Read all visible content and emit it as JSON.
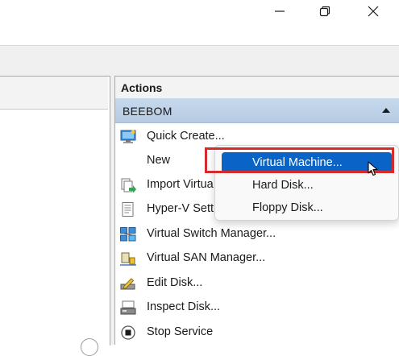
{
  "window": {
    "controls": [
      {
        "name": "minimize-icon"
      },
      {
        "name": "maximize-icon"
      },
      {
        "name": "close-icon"
      }
    ]
  },
  "actions": {
    "title": "Actions",
    "group": "BEEBOM",
    "items": [
      {
        "label": "Quick Create...",
        "icon": "quick-create-icon"
      },
      {
        "label": "New",
        "icon": ""
      },
      {
        "label": "Import Virtua",
        "icon": "import-icon"
      },
      {
        "label": "Hyper-V Sett",
        "icon": "settings-icon"
      },
      {
        "label": "Virtual Switch Manager...",
        "icon": "switch-manager-icon"
      },
      {
        "label": "Virtual SAN Manager...",
        "icon": "san-manager-icon"
      },
      {
        "label": "Edit Disk...",
        "icon": "edit-disk-icon"
      },
      {
        "label": "Inspect Disk...",
        "icon": "inspect-disk-icon"
      },
      {
        "label": "Stop Service",
        "icon": "stop-service-icon"
      }
    ]
  },
  "new_submenu": {
    "items": [
      {
        "label": "Virtual Machine...",
        "selected": true
      },
      {
        "label": "Hard Disk...",
        "selected": false
      },
      {
        "label": "Floppy Disk...",
        "selected": false
      }
    ]
  },
  "colors": {
    "selection": "#0a64c8",
    "highlight_box": "#d62b2b",
    "group_bar": "#c7d9ec"
  }
}
